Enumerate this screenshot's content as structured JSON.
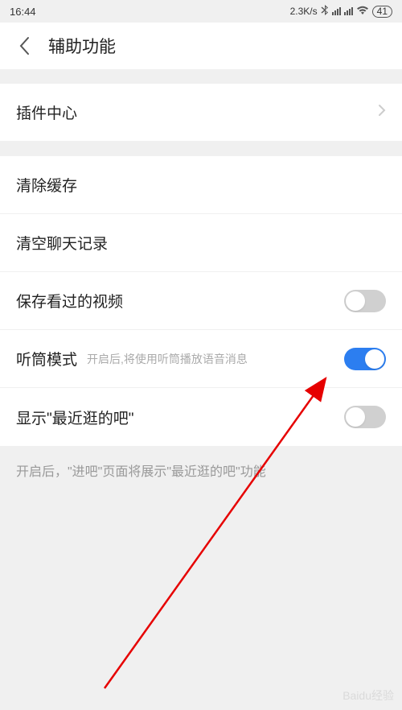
{
  "status": {
    "time": "16:44",
    "speed": "2.3K/s",
    "battery": "41"
  },
  "header": {
    "title": "辅助功能"
  },
  "items": {
    "plugin_center": "插件中心",
    "clear_cache": "清除缓存",
    "clear_chat": "清空聊天记录",
    "save_video": "保存看过的视频",
    "earpiece_mode": "听筒模式",
    "earpiece_desc": "开启后,将使用听筒播放语音消息",
    "show_recent": "显示\"最近逛的吧\""
  },
  "footer": "开启后，\"进吧\"页面将展示\"最近逛的吧\"功能",
  "watermark": "Baidu经验"
}
